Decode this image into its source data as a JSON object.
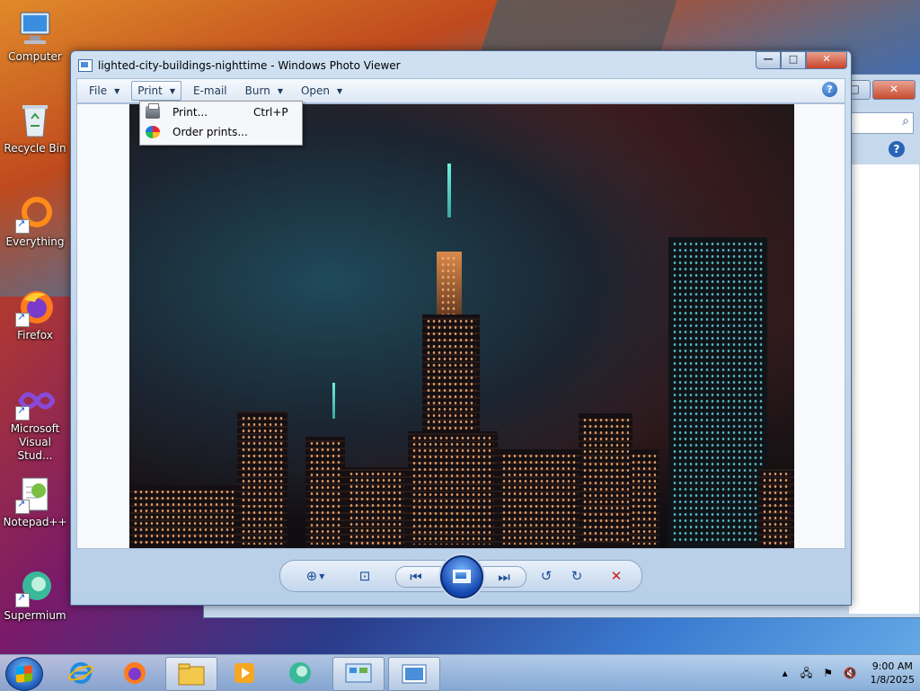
{
  "desktop": {
    "icons": [
      {
        "label": "Computer",
        "icon": "computer-icon"
      },
      {
        "label": "Recycle Bin",
        "icon": "recycle-bin-icon"
      },
      {
        "label": "Everything",
        "icon": "everything-icon"
      },
      {
        "label": "Firefox",
        "icon": "firefox-icon"
      },
      {
        "label": "Microsoft Visual Stud...",
        "icon": "visual-studio-icon"
      },
      {
        "label": "Notepad++",
        "icon": "notepadpp-icon"
      },
      {
        "label": "Supermium",
        "icon": "supermium-icon"
      }
    ]
  },
  "background_window": {
    "close_glyph": "✕",
    "maximize_glyph": "□",
    "search_icon": "⌕",
    "help_glyph": "?"
  },
  "photo_viewer": {
    "title": "lighted-city-buildings-nighttime - Windows Photo Viewer",
    "caption_buttons": {
      "minimize": "—",
      "maximize": "□",
      "close": "✕"
    },
    "menu": [
      {
        "label": "File",
        "has_arrow": true
      },
      {
        "label": "Print",
        "has_arrow": true,
        "active": true
      },
      {
        "label": "E-mail",
        "has_arrow": false
      },
      {
        "label": "Burn",
        "has_arrow": true
      },
      {
        "label": "Open",
        "has_arrow": true
      }
    ],
    "help_glyph": "?",
    "dropdown": [
      {
        "label": "Print...",
        "shortcut": "Ctrl+P",
        "icon": "printer-icon"
      },
      {
        "label": "Order prints...",
        "shortcut": "",
        "icon": "order-prints-icon"
      }
    ],
    "controls": {
      "zoom": "⊕",
      "fit": "⊡",
      "previous": "⏮",
      "next": "⏭",
      "rotate_ccw": "↺",
      "rotate_cw": "↻",
      "delete": "✕"
    }
  },
  "taskbar": {
    "clock_time": "9:00 AM",
    "clock_date": "1/8/2025",
    "apps": [
      "internet-explorer-icon",
      "firefox-icon",
      "file-explorer-icon",
      "media-player-icon",
      "supermium-icon",
      "control-panel-icon",
      "photo-viewer-icon"
    ]
  }
}
